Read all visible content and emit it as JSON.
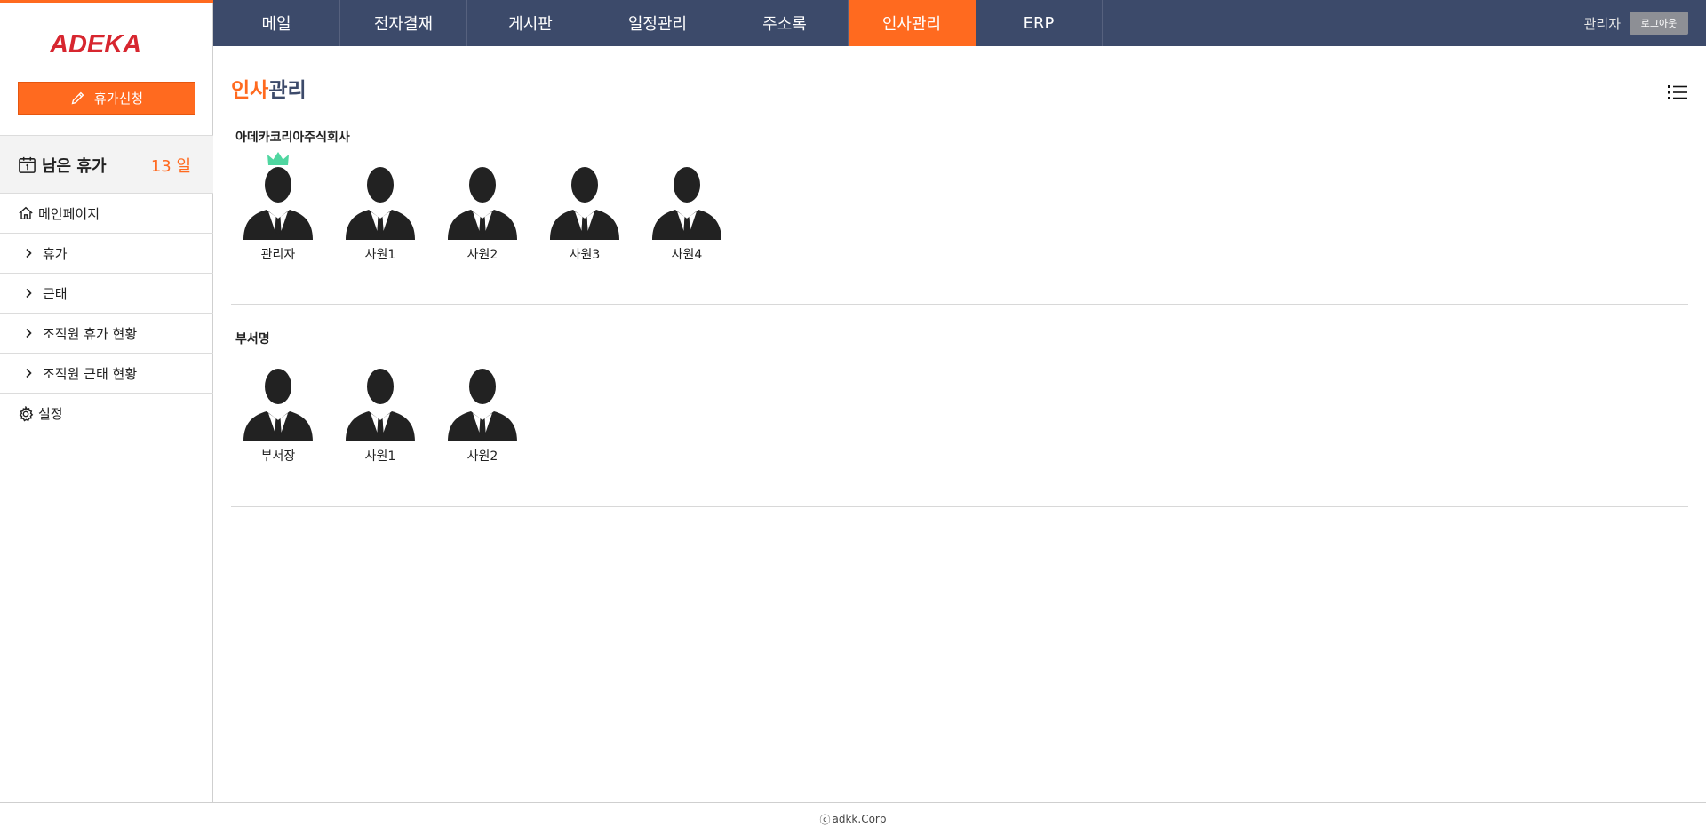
{
  "logo": {
    "text": "ADEKA"
  },
  "sidebar": {
    "leave_button": "휴가신청",
    "remaining": {
      "label": "남은 휴가",
      "value": "13 일"
    },
    "items": [
      {
        "label": "메인페이지",
        "icon": "home-icon"
      },
      {
        "label": "휴가",
        "icon": "chevron-right-icon"
      },
      {
        "label": "근태",
        "icon": "chevron-right-icon"
      },
      {
        "label": "조직원 휴가 현황",
        "icon": "chevron-right-icon"
      },
      {
        "label": "조직원 근태 현황",
        "icon": "chevron-right-icon"
      },
      {
        "label": "설정",
        "icon": "gear-icon"
      }
    ]
  },
  "topnav": {
    "tabs": [
      "메일",
      "전자결재",
      "게시판",
      "일정관리",
      "주소록",
      "인사관리",
      "ERP"
    ],
    "active_tab": "인사관리",
    "user_name": "관리자",
    "logout_label": "로그아웃"
  },
  "page": {
    "title_accent": "인사",
    "title_rest": "관리"
  },
  "groups": [
    {
      "title": "아데카코리아주식회사",
      "members": [
        "관리자",
        "사원1",
        "사원2",
        "사원3",
        "사원4"
      ],
      "leader_crown": true
    },
    {
      "title": "부서명",
      "members": [
        "부서장",
        "사원1",
        "사원2"
      ],
      "leader_crown": false
    }
  ],
  "footer": {
    "copyright_symbol": "ⓒ",
    "text": "adkk.Corp"
  },
  "colors": {
    "accent": "#ff6a1f",
    "nav_bg": "#3c4a6a",
    "crown": "#4fd6a0"
  }
}
